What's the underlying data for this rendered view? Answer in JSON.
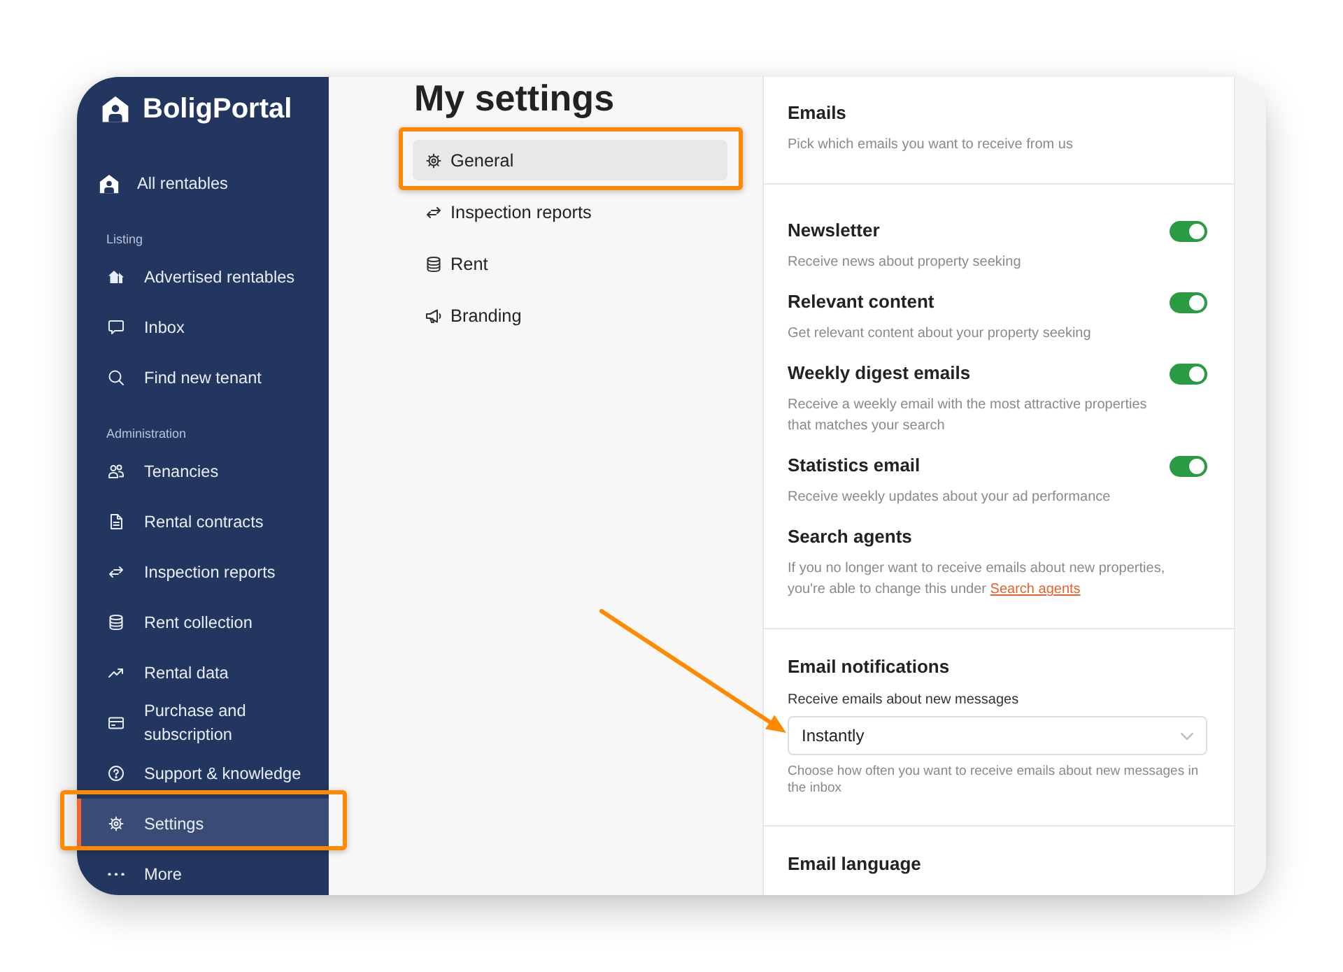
{
  "sidebar": {
    "logo": "BoligPortal",
    "top_items": [
      {
        "label": "All rentables",
        "selected": false,
        "highlighted": false
      }
    ],
    "sections": [
      {
        "heading": "Listing",
        "items": [
          {
            "label": "Advertised rentables",
            "selected": false,
            "highlighted": false
          },
          {
            "label": "Inbox",
            "selected": false,
            "highlighted": false
          },
          {
            "label": "Find new tenant",
            "selected": false,
            "highlighted": false
          }
        ]
      },
      {
        "heading": "Administration",
        "items": [
          {
            "label": "Tenancies",
            "selected": false,
            "highlighted": false
          },
          {
            "label": "Rental contracts",
            "selected": false,
            "highlighted": false
          },
          {
            "label": "Inspection reports",
            "selected": false,
            "highlighted": false
          },
          {
            "label": "Rent collection",
            "selected": false,
            "highlighted": false
          },
          {
            "label": "Rental data",
            "selected": false,
            "highlighted": false
          },
          {
            "label": "Purchase and subscription",
            "selected": false,
            "highlighted": false
          },
          {
            "label": "Support & knowledge",
            "selected": false,
            "highlighted": false
          },
          {
            "label": "Settings",
            "selected": true,
            "highlighted": true
          },
          {
            "label": "More",
            "selected": false,
            "highlighted": false
          }
        ]
      }
    ]
  },
  "settings_menu": {
    "title": "My settings",
    "items": [
      {
        "label": "General",
        "selected": true,
        "highlighted": true
      },
      {
        "label": "Inspection reports",
        "selected": false,
        "highlighted": false
      },
      {
        "label": "Rent",
        "selected": false,
        "highlighted": false
      },
      {
        "label": "Branding",
        "selected": false,
        "highlighted": false
      }
    ]
  },
  "panel": {
    "emails": {
      "title": "Emails",
      "description": "Pick which emails you want to receive from us"
    },
    "subscriptions": [
      {
        "title": "Newsletter",
        "description": "Receive news about property seeking",
        "on": true
      },
      {
        "title": "Relevant content",
        "description": "Get relevant content about your property seeking",
        "on": true
      },
      {
        "title": "Weekly digest emails",
        "description": "Receive a weekly email with the most attractive properties that matches your search",
        "on": true
      },
      {
        "title": "Statistics email",
        "description": "Receive weekly updates about your ad performance",
        "on": true
      }
    ],
    "search_agents": {
      "title": "Search agents",
      "description": "If you no longer want to receive emails about new properties, you're able to change this under",
      "link": "Search agents"
    },
    "email_notifications": {
      "title": "Email notifications",
      "label": "Receive emails about new messages",
      "select": {
        "value": "Instantly",
        "pointed_at": true
      },
      "help": "Choose how often you want to receive emails about new messages in the inbox"
    },
    "email_language": {
      "title": "Email language"
    }
  }
}
